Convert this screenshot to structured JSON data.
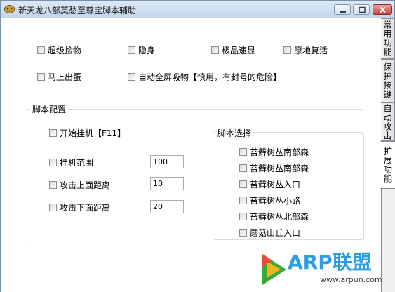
{
  "window": {
    "title": "新天龙八部莫愁至尊宝脚本辅助",
    "controls": {
      "minimize": "minimize-icon",
      "maximize": "maximize-icon",
      "close": "close-icon"
    }
  },
  "options": {
    "row1": [
      "超级捡物",
      "隐身",
      "极品速显",
      "原地复活"
    ],
    "row2": [
      "马上出蛋",
      "自动全屏吸物【慎用，有封号的危险】"
    ]
  },
  "script_config": {
    "title": "脚本配置",
    "start_label": "开始挂机【F11】",
    "fields": [
      {
        "label": "挂机范围",
        "value": "100"
      },
      {
        "label": "攻击上面距离",
        "value": "10"
      },
      {
        "label": "攻击下面距离",
        "value": "20"
      }
    ]
  },
  "script_select": {
    "title": "脚本选择",
    "items": [
      "苔藓树丛南部森",
      "苔藓树丛南部森",
      "苔藓树丛入口",
      "苔藓树丛小路",
      "苔藓树丛北部森",
      "蘑菇山丘入口"
    ]
  },
  "tabs": [
    "常用功能",
    "保护按键",
    "自动攻击",
    "扩展功能"
  ],
  "active_tab": "扩展功能",
  "watermark": {
    "brand": "ARP联盟",
    "url": "www.arpun.com"
  },
  "colors": {
    "titlebar": "#c4d6ec",
    "close_button": "#c7443a",
    "watermark": "#2c9de0"
  }
}
